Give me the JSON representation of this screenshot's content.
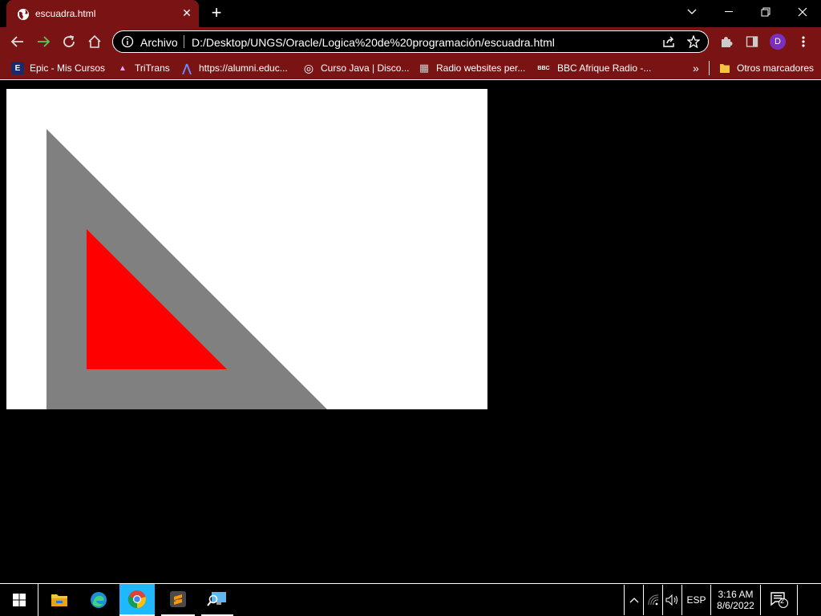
{
  "tab": {
    "title": "escuadra.html",
    "close": "✕"
  },
  "newtab": "+",
  "omnibox": {
    "chip": "Archivo",
    "url": "D:/Desktop/UNGS/Oracle/Logica%20de%20programación/escuadra.html"
  },
  "profile": {
    "initial": "D"
  },
  "bookmarks": [
    {
      "label": "Epic - Mis Cursos",
      "icon": "E"
    },
    {
      "label": "TriTrans",
      "icon": "▲"
    },
    {
      "label": "https://alumni.educ...",
      "icon": "⋀"
    },
    {
      "label": "Curso Java | Disco...",
      "icon": "◎"
    },
    {
      "label": "Radio websites per...",
      "icon": "▦"
    },
    {
      "label": "BBC Afrique Radio -...",
      "icon": "BBC"
    }
  ],
  "bookmarks_overflow": "»",
  "other_bookmarks": "Otros marcadores",
  "canvas": {
    "outer_color": "#808080",
    "inner_color": "#ff0000",
    "background": "#ffffff"
  },
  "system_tray": {
    "language": "ESP",
    "time": "3:16 AM",
    "date": "8/6/2022",
    "notifications": "2"
  },
  "colors": {
    "theme": "#7a1414",
    "profile": "#7b2fbe"
  }
}
